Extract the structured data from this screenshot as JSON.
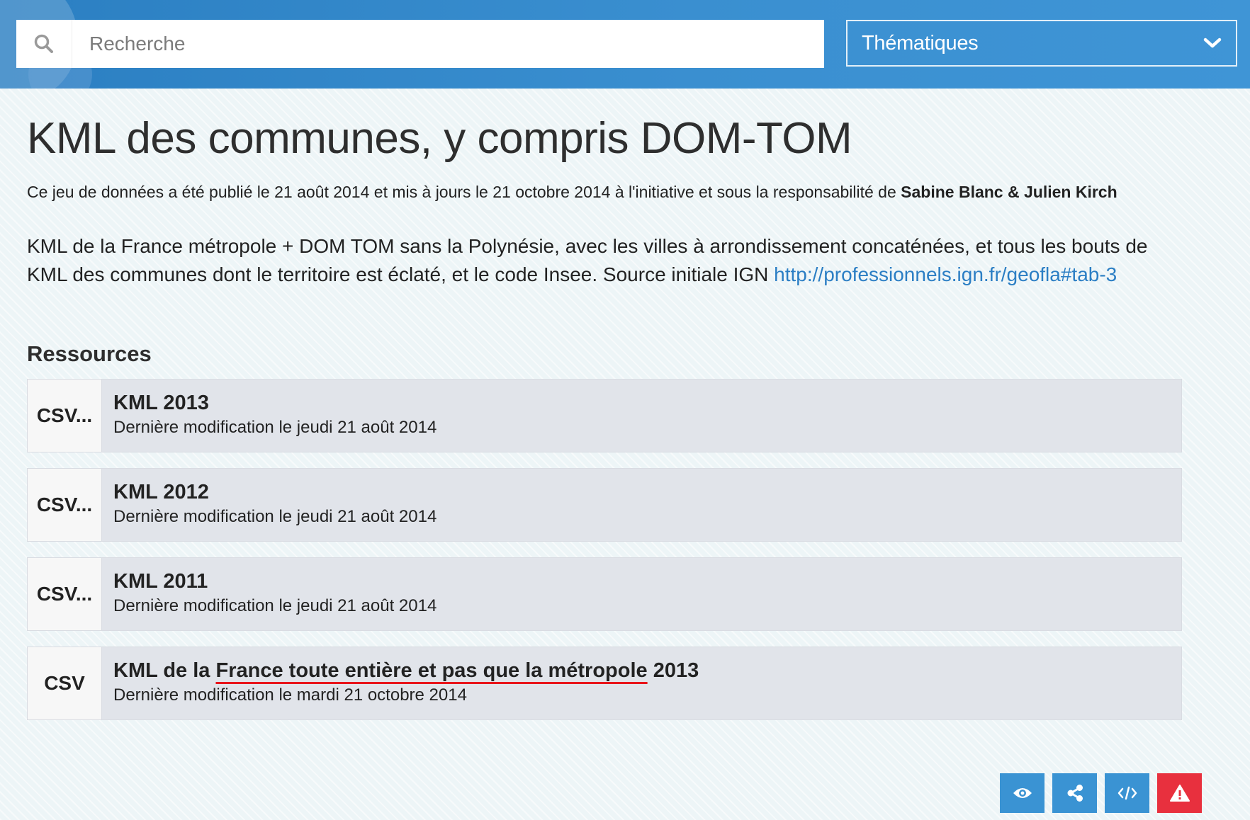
{
  "header": {
    "search": {
      "placeholder": "Recherche",
      "value": ""
    },
    "thematiques_label": "Thématiques"
  },
  "dataset": {
    "title": "KML des communes, y compris DOM-TOM",
    "meta_prefix": "Ce jeu de données a été publié le 21 août 2014 et mis à jours le 21 octobre 2014 à l'initiative et sous la responsabilité de ",
    "authors": "Sabine Blanc & Julien Kirch",
    "description_text": "KML de la France métropole + DOM TOM sans la Polynésie, avec les villes à arrondissement concaténées, et tous les bouts de KML des communes dont le territoire est éclaté, et le code Insee. Source initiale IGN ",
    "source_link": "http://professionnels.ign.fr/geofla#tab-3"
  },
  "resources": {
    "title": "Ressources",
    "items": [
      {
        "format": "CSV...",
        "name": "KML 2013",
        "date": "Dernière modification le jeudi 21 août 2014"
      },
      {
        "format": "CSV...",
        "name": "KML 2012",
        "date": "Dernière modification le jeudi 21 août 2014"
      },
      {
        "format": "CSV...",
        "name": "KML 2011",
        "date": "Dernière modification le jeudi 21 août 2014"
      },
      {
        "format": "CSV",
        "name_prefix": "KML de la ",
        "name_underlined": "France toute entière et pas que la métropole",
        "name_suffix": " 2013",
        "date": "Dernière modification le mardi 21 octobre 2014"
      }
    ]
  },
  "actions": [
    {
      "icon": "eye-icon",
      "color": "#3a93d3"
    },
    {
      "icon": "share-icon",
      "color": "#3a93d3"
    },
    {
      "icon": "code-icon",
      "color": "#3a93d3"
    },
    {
      "icon": "warning-icon",
      "color": "#e8303e"
    }
  ],
  "colors": {
    "accent": "#2b7ec4",
    "header": "#3a8fd0",
    "alert": "#e8303e",
    "underline": "#e8151b"
  }
}
